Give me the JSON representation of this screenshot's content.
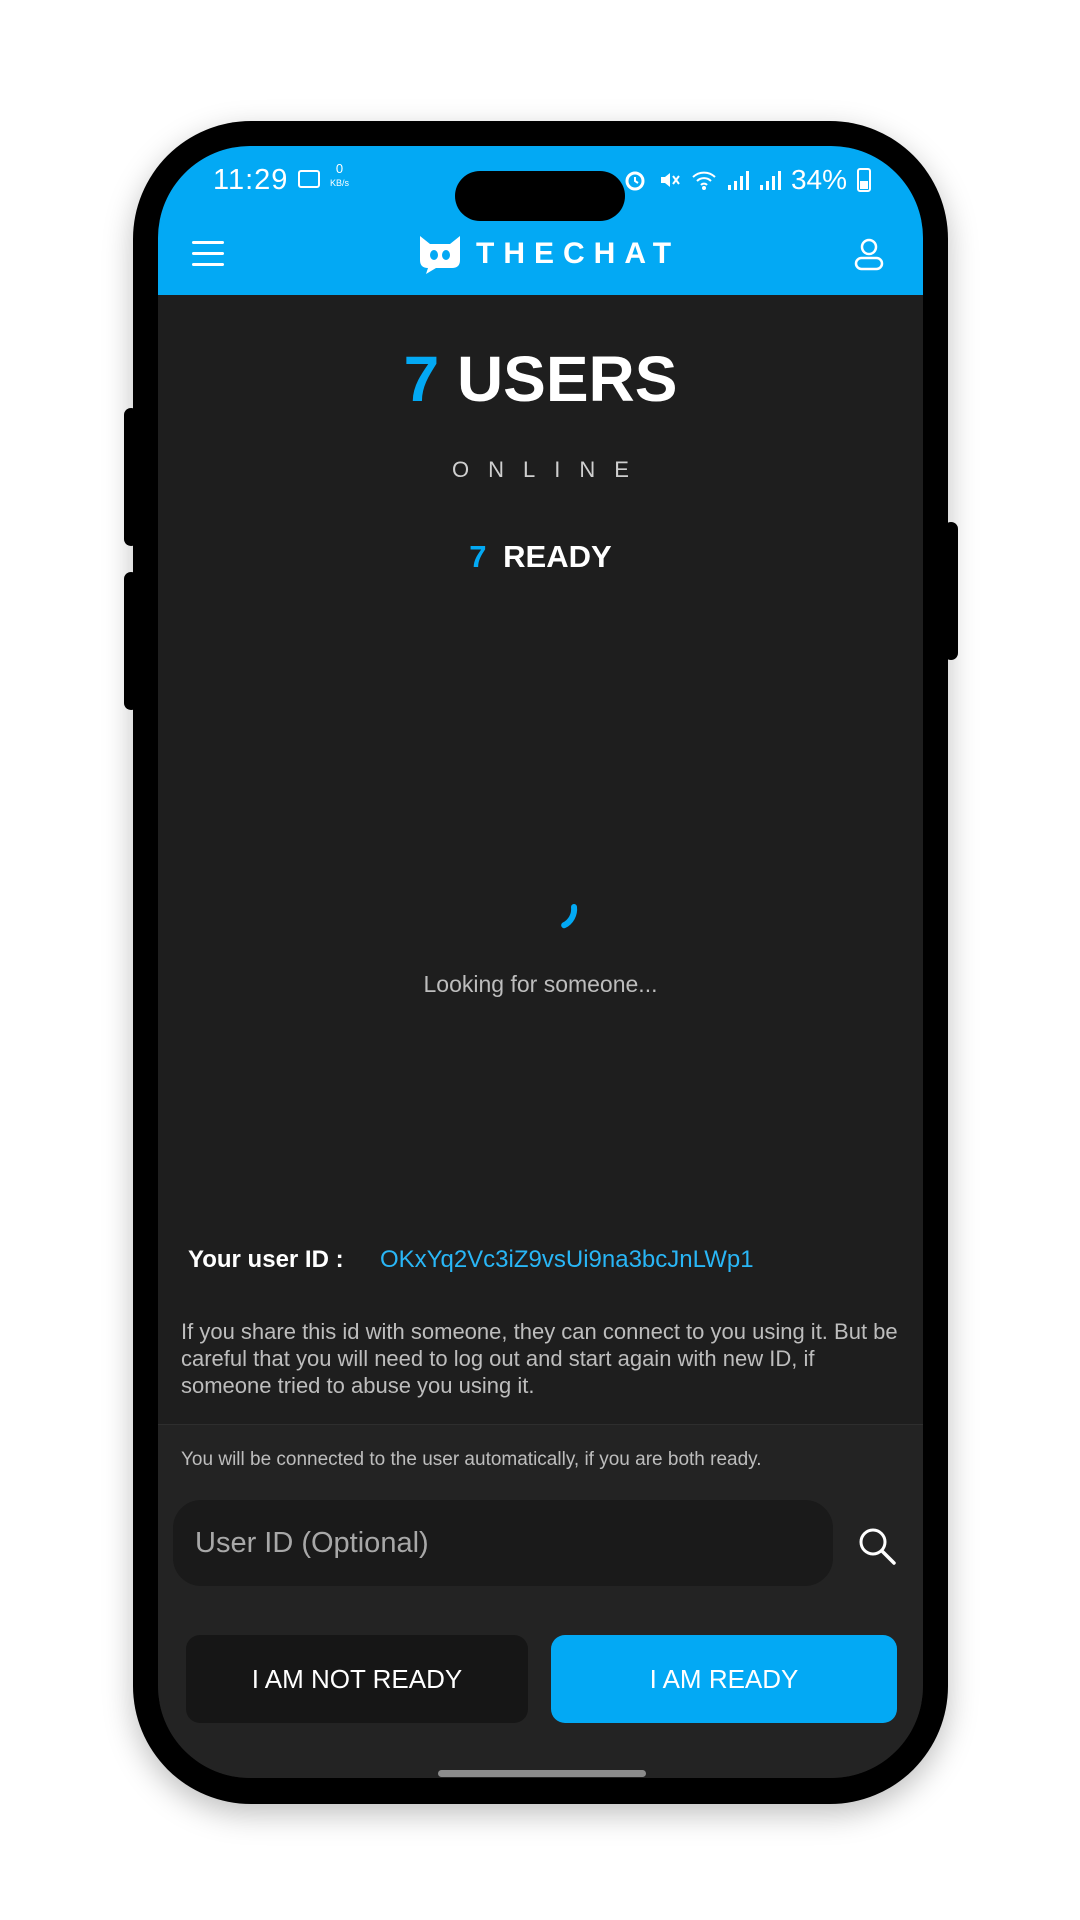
{
  "status_bar": {
    "time": "11:29",
    "kbs_value": "0",
    "kbs_unit": "KB/s",
    "battery": "34%"
  },
  "header": {
    "logo_text": "THECHAT"
  },
  "stats": {
    "users_count": "7",
    "users_label": "USERS",
    "online_label": "ONLINE",
    "ready_count": "7",
    "ready_label": "READY"
  },
  "search_status": "Looking for someone...",
  "user_id": {
    "label": "Your user ID :",
    "value": "OKxYq2Vc3iZ9vsUi9na3bcJnLWp1"
  },
  "share_note": "If you share this id with someone, they can connect to you using it. But be careful that you will need to log out and start again with new ID, if someone tried to abuse you using it.",
  "bottom": {
    "auto_note": "You will be connected to the user automatically, if you are both ready.",
    "input_placeholder": "User ID (Optional)",
    "not_ready_label": "I AM NOT READY",
    "ready_label": "I AM READY"
  },
  "colors": {
    "accent": "#03a9f4",
    "background": "#1e1e1e",
    "panel": "#232323"
  },
  "icons": [
    "menu-icon",
    "logo-icon",
    "user-profile-icon",
    "loading-spinner-icon",
    "search-icon"
  ]
}
